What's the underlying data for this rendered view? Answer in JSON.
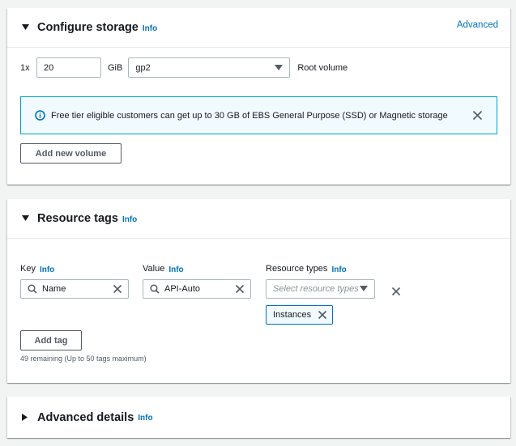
{
  "storage": {
    "title": "Configure storage",
    "info": "Info",
    "advanced_link": "Advanced",
    "volume": {
      "multiplier": "1x",
      "size": "20",
      "unit": "GiB",
      "type": "gp2",
      "label": "Root volume"
    },
    "notice": "Free tier eligible customers can get up to 30 GB of EBS General Purpose (SSD) or Magnetic storage",
    "add_volume": "Add new volume"
  },
  "tags": {
    "title": "Resource tags",
    "info": "Info",
    "key_label": "Key",
    "value_label": "Value",
    "resource_types_label": "Resource types",
    "key_value": "Name",
    "value_value": "API-Auto",
    "resource_types_placeholder": "Select resource types",
    "selected_types": [
      "Instances"
    ],
    "add_tag": "Add tag",
    "remaining": "49 remaining (Up to 50 tags maximum)"
  },
  "advanced_details": {
    "title": "Advanced details",
    "info": "Info"
  },
  "colors": {
    "link": "#0073bb",
    "notice_border": "#00a1c9",
    "notice_bg": "#f1faff",
    "text": "#16191f"
  }
}
